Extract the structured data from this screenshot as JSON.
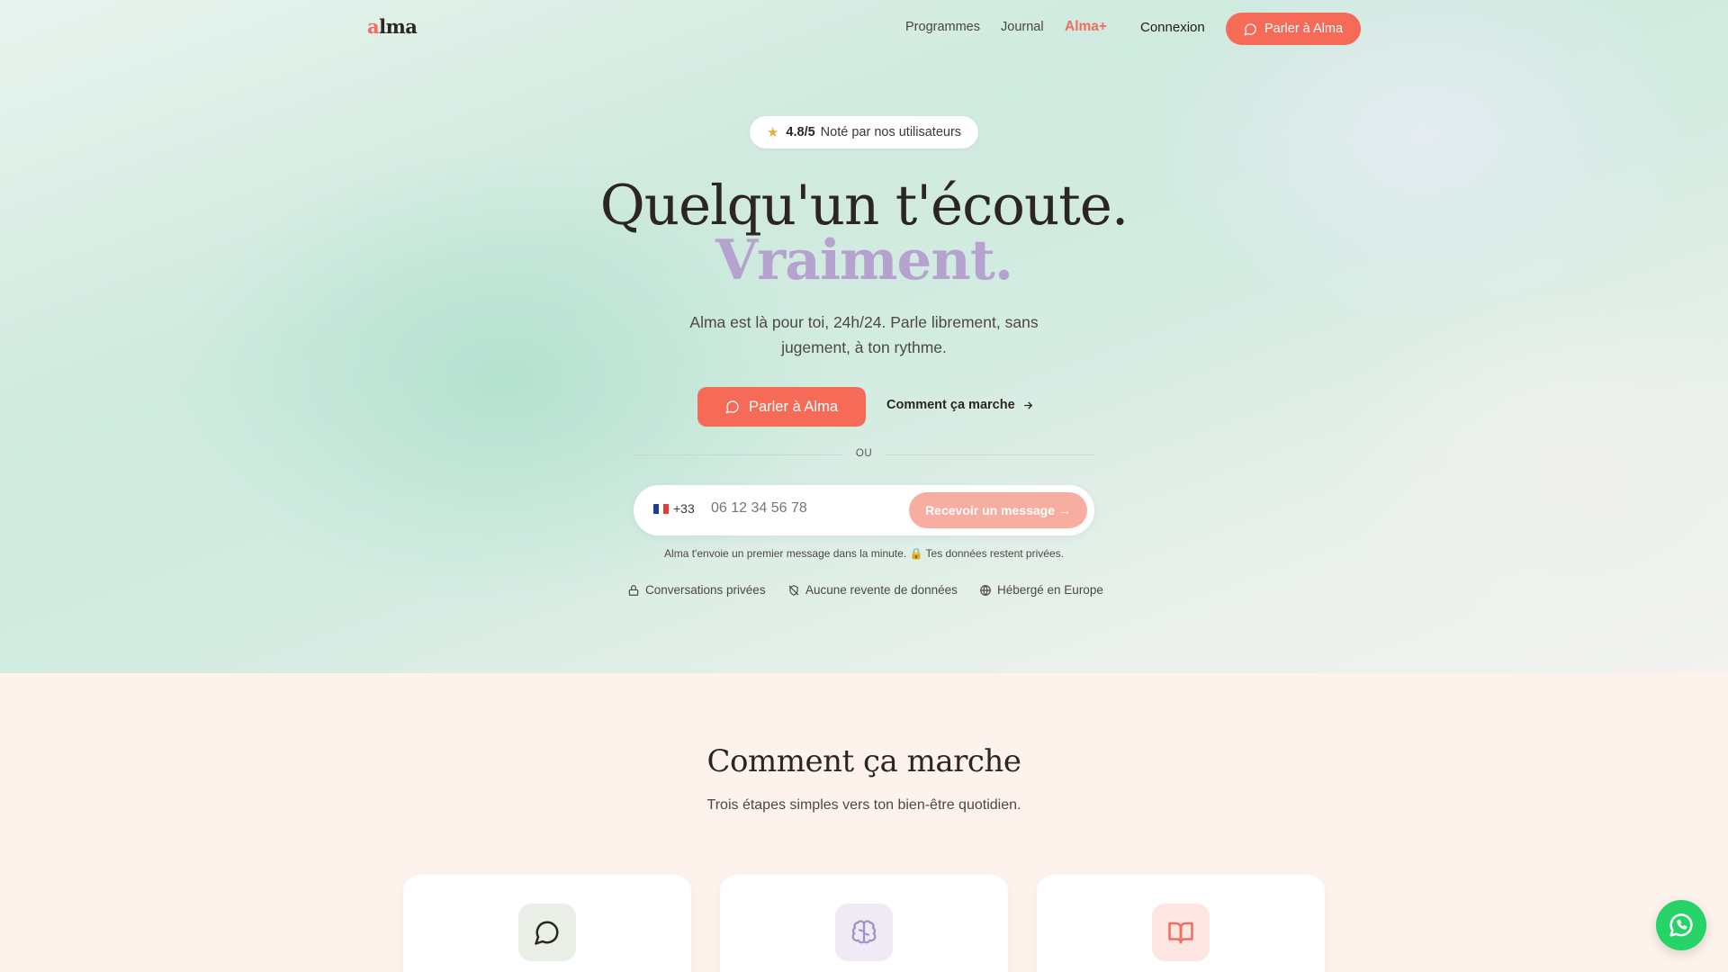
{
  "brand": {
    "logo_first": "a",
    "logo_rest": "lma",
    "accent": "#f66a58",
    "lavender": "#b5a2cf"
  },
  "nav": {
    "items": [
      {
        "label": "Programmes"
      },
      {
        "label": "Journal"
      },
      {
        "label": "Alma+"
      },
      {
        "label": "Connexion"
      }
    ],
    "cta_label": "Parler à Alma",
    "cta_icon": "chat-bubble-icon"
  },
  "hero": {
    "rating_score": "4.8/5",
    "rating_text": "Noté par nos utilisateurs",
    "rating_icon": "star-icon",
    "title_line1": "Quelqu'un t'écoute.",
    "title_line2": "Vraiment.",
    "subtitle": "Alma est là pour toi, 24h/24. Parle librement, sans jugement, à ton rythme.",
    "primary_cta": "Parler à Alma",
    "secondary_cta": "Comment ça marche",
    "divider_label": "OU",
    "phone": {
      "country_code": "+33",
      "placeholder": "06 12 34 56 78",
      "submit_label": "Recevoir un message →"
    },
    "note": "Alma t'envoie un premier message dans la minute. 🔒 Tes données restent privées.",
    "trust": [
      {
        "label": "Conversations privées",
        "icon": "lock-icon"
      },
      {
        "label": "Aucune revente de données",
        "icon": "no-share-icon"
      },
      {
        "label": "Hébergé en Europe",
        "icon": "globe-icon"
      }
    ]
  },
  "how": {
    "title": "Comment ça marche",
    "subtitle": "Trois étapes simples vers ton bien-être quotidien.",
    "cards": [
      {
        "icon": "chat-bubble-icon",
        "bg": "#e9efe6"
      },
      {
        "icon": "brain-icon",
        "bg": "#efeaf4"
      },
      {
        "icon": "open-book-icon",
        "bg": "#fde6e2"
      }
    ]
  },
  "floating": {
    "icon": "whatsapp-icon"
  }
}
